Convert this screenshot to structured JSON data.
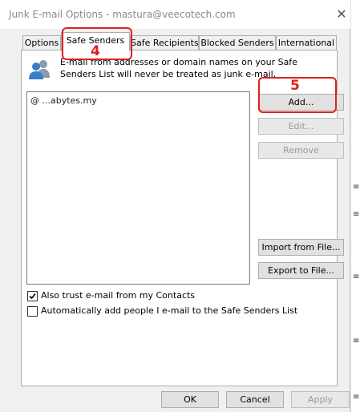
{
  "window": {
    "title": "Junk E-mail Options - mastura@veecotech.com",
    "close_glyph": "✕"
  },
  "background": {
    "top_strip_text": "",
    "right_marks": [
      "≡",
      "≡",
      "≡",
      "≡",
      "≡"
    ]
  },
  "tabs": [
    {
      "label": "Options",
      "active": false
    },
    {
      "label": "Safe Senders",
      "active": true
    },
    {
      "label": "Safe Recipients",
      "active": false
    },
    {
      "label": "Blocked Senders",
      "active": false
    },
    {
      "label": "International",
      "active": false
    }
  ],
  "description": "E-mail from addresses or domain names on your Safe Senders List will never be treated as junk e-mail.",
  "list": {
    "entries": [
      "@ ...abytes.my"
    ]
  },
  "buttons": {
    "add": "Add...",
    "edit": "Edit...",
    "remove": "Remove",
    "import": "Import from File...",
    "export": "Export to File..."
  },
  "checkboxes": [
    {
      "label": "Also trust e-mail from my Contacts",
      "checked": true
    },
    {
      "label": "Automatically add people I e-mail to the Safe Senders List",
      "checked": false
    }
  ],
  "footer": {
    "ok": "OK",
    "cancel": "Cancel",
    "apply": "Apply"
  },
  "annotations": {
    "tab_number": "4",
    "add_number": "5",
    "color": "#e02020"
  },
  "colors": {
    "people_icon_blue": "#3a7dc9",
    "people_icon_gray": "#8a9bb0"
  }
}
